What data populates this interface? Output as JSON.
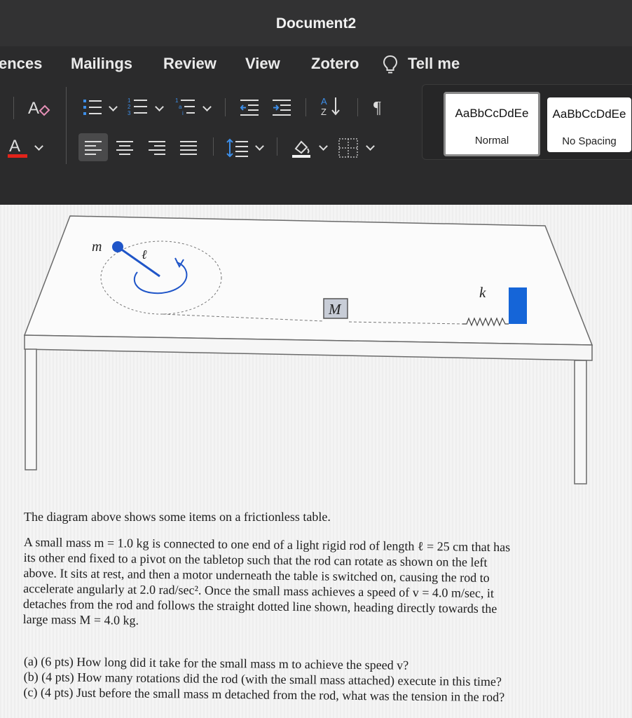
{
  "window": {
    "title": "Document2"
  },
  "tabs": [
    "ences",
    "Mailings",
    "Review",
    "View",
    "Zotero",
    "Tell me"
  ],
  "ribbon": {
    "font_color": "#e2231a",
    "styles": [
      {
        "sample": "AaBbCcDdEe",
        "name": "Normal"
      },
      {
        "sample": "AaBbCcDdEe",
        "name": "No Spacing"
      }
    ]
  },
  "diagram": {
    "labels": {
      "small_mass": "m",
      "rod": "ℓ",
      "large_mass": "M",
      "spring": "k"
    },
    "colors": {
      "mass": "#1f55c8",
      "block": "#1565d8"
    }
  },
  "text": {
    "intro": "The diagram above shows some items on a frictionless table.",
    "body_lines": [
      "A small mass m = 1.0 kg is connected to one end of a light rigid rod of length ℓ = 25 cm that has",
      "its other end fixed to a pivot on the tabletop such that the rod can rotate as shown on the left",
      "above. It sits at rest, and then a motor underneath the table is switched on, causing the rod to",
      "accelerate angularly at 2.0 rad/sec². Once the small mass achieves a speed of v = 4.0 m/sec, it",
      "detaches from the rod and follows the straight dotted line shown, heading directly towards the",
      "large mass M = 4.0 kg."
    ],
    "questions": [
      "(a) (6 pts) How long did it take for the small mass m to achieve the speed v?",
      "(b) (4 pts) How many rotations did the rod (with the small mass attached) execute in this time?",
      "(c) (4 pts) Just before the small mass m detached from the rod, what was the tension in the rod?"
    ]
  }
}
